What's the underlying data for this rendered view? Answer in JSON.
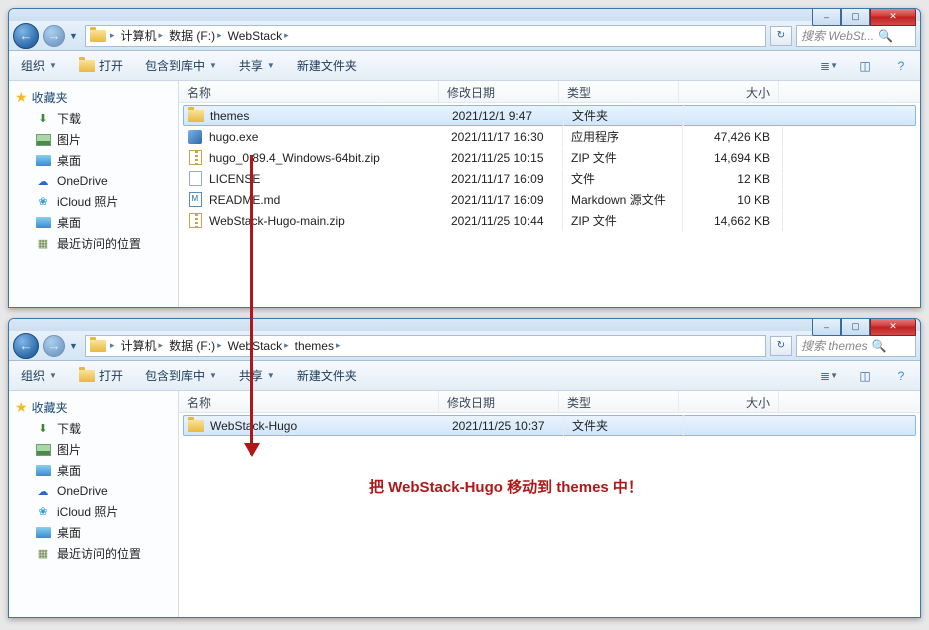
{
  "windows": [
    {
      "breadcrumbs": [
        "计算机",
        "数据 (F:)",
        "WebStack"
      ],
      "search_placeholder": "搜索 WebSt...",
      "toolbar": {
        "organize": "组织",
        "open": "打开",
        "library": "包含到库中",
        "share": "共享",
        "new_folder": "新建文件夹"
      },
      "sidebar": {
        "favorites_label": "收藏夹",
        "items": [
          {
            "icon": "download",
            "label": "下载"
          },
          {
            "icon": "pictures",
            "label": "图片"
          },
          {
            "icon": "desktop",
            "label": "桌面"
          },
          {
            "icon": "onedrive",
            "label": "OneDrive"
          },
          {
            "icon": "icloud",
            "label": "iCloud 照片"
          },
          {
            "icon": "desktop",
            "label": "桌面"
          },
          {
            "icon": "recent",
            "label": "最近访问的位置"
          }
        ]
      },
      "columns": {
        "name": "名称",
        "date": "修改日期",
        "type": "类型",
        "size": "大小"
      },
      "rows": [
        {
          "icon": "folder",
          "name": "themes",
          "date": "2021/12/1 9:47",
          "type": "文件夹",
          "size": "",
          "selected": true
        },
        {
          "icon": "exe",
          "name": "hugo.exe",
          "date": "2021/11/17 16:30",
          "type": "应用程序",
          "size": "47,426 KB"
        },
        {
          "icon": "zip",
          "name": "hugo_0.89.4_Windows-64bit.zip",
          "date": "2021/11/25 10:15",
          "type": "ZIP 文件",
          "size": "14,694 KB"
        },
        {
          "icon": "file",
          "name": "LICENSE",
          "date": "2021/11/17 16:09",
          "type": "文件",
          "size": "12 KB"
        },
        {
          "icon": "md",
          "name": "README.md",
          "date": "2021/11/17 16:09",
          "type": "Markdown 源文件",
          "size": "10 KB"
        },
        {
          "icon": "zip",
          "name": "WebStack-Hugo-main.zip",
          "date": "2021/11/25 10:44",
          "type": "ZIP 文件",
          "size": "14,662 KB"
        }
      ]
    },
    {
      "breadcrumbs": [
        "计算机",
        "数据 (F:)",
        "WebStack",
        "themes"
      ],
      "search_placeholder": "搜索 themes",
      "toolbar": {
        "organize": "组织",
        "open": "打开",
        "library": "包含到库中",
        "share": "共享",
        "new_folder": "新建文件夹"
      },
      "sidebar": {
        "favorites_label": "收藏夹",
        "items": [
          {
            "icon": "download",
            "label": "下载"
          },
          {
            "icon": "pictures",
            "label": "图片"
          },
          {
            "icon": "desktop",
            "label": "桌面"
          },
          {
            "icon": "onedrive",
            "label": "OneDrive"
          },
          {
            "icon": "icloud",
            "label": "iCloud 照片"
          },
          {
            "icon": "desktop",
            "label": "桌面"
          },
          {
            "icon": "recent",
            "label": "最近访问的位置"
          }
        ]
      },
      "columns": {
        "name": "名称",
        "date": "修改日期",
        "type": "类型",
        "size": "大小"
      },
      "rows": [
        {
          "icon": "folder",
          "name": "WebStack-Hugo",
          "date": "2021/11/25 10:37",
          "type": "文件夹",
          "size": "",
          "selected": true
        }
      ],
      "annotation": "把 WebStack-Hugo 移动到 themes 中！"
    }
  ],
  "win_controls": {
    "min": "–",
    "max": "▢",
    "close": "✕"
  }
}
